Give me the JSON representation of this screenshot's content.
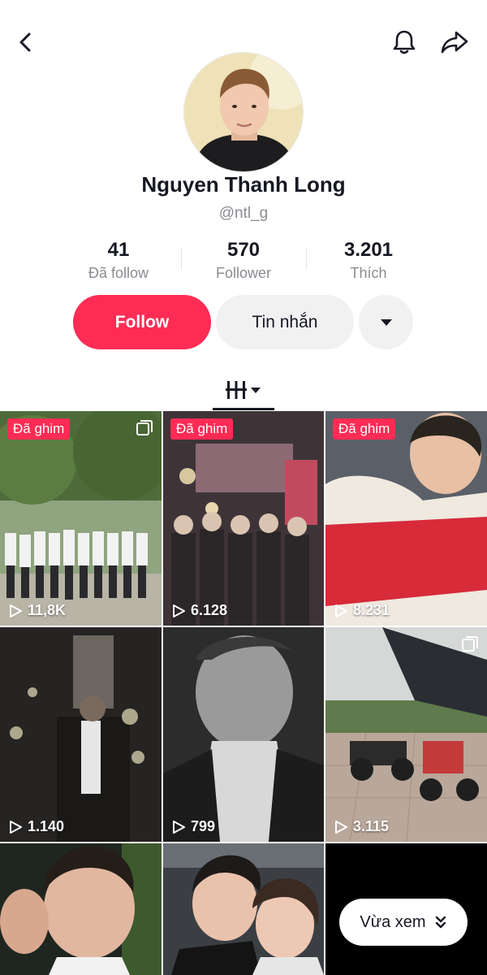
{
  "header": {
    "back_icon": "back-chevron-icon",
    "bell_icon": "bell-icon",
    "share_icon": "share-arrow-icon"
  },
  "profile": {
    "display_name": "Nguyen Thanh Long",
    "handle": "@ntl_g",
    "avatar_icon": "profile-avatar"
  },
  "stats": [
    {
      "value": "41",
      "label": "Đã follow"
    },
    {
      "value": "570",
      "label": "Follower"
    },
    {
      "value": "3.201",
      "label": "Thích"
    }
  ],
  "actions": {
    "follow_label": "Follow",
    "message_label": "Tin nhắn",
    "more_icon": "caret-down-icon"
  },
  "tabs": {
    "active_icon": "videos-grid-icon"
  },
  "videos": [
    {
      "pinned": "Đã ghim",
      "views": "11,8K",
      "multi": true
    },
    {
      "pinned": "Đã ghim",
      "views": "6.128",
      "multi": false
    },
    {
      "pinned": "Đã ghim",
      "views": "8.231",
      "multi": false
    },
    {
      "pinned": "",
      "views": "1.140",
      "multi": false
    },
    {
      "pinned": "",
      "views": "799",
      "multi": false
    },
    {
      "pinned": "",
      "views": "3.115",
      "multi": true
    },
    {
      "pinned": "",
      "views": "",
      "multi": false
    },
    {
      "pinned": "",
      "views": "",
      "multi": false
    }
  ],
  "floating": {
    "recently_viewed_label": "Vừa xem",
    "icon": "double-chevron-down-icon"
  },
  "colors": {
    "accent": "#fe2c55",
    "text": "#161823",
    "muted": "#8a8b91"
  }
}
